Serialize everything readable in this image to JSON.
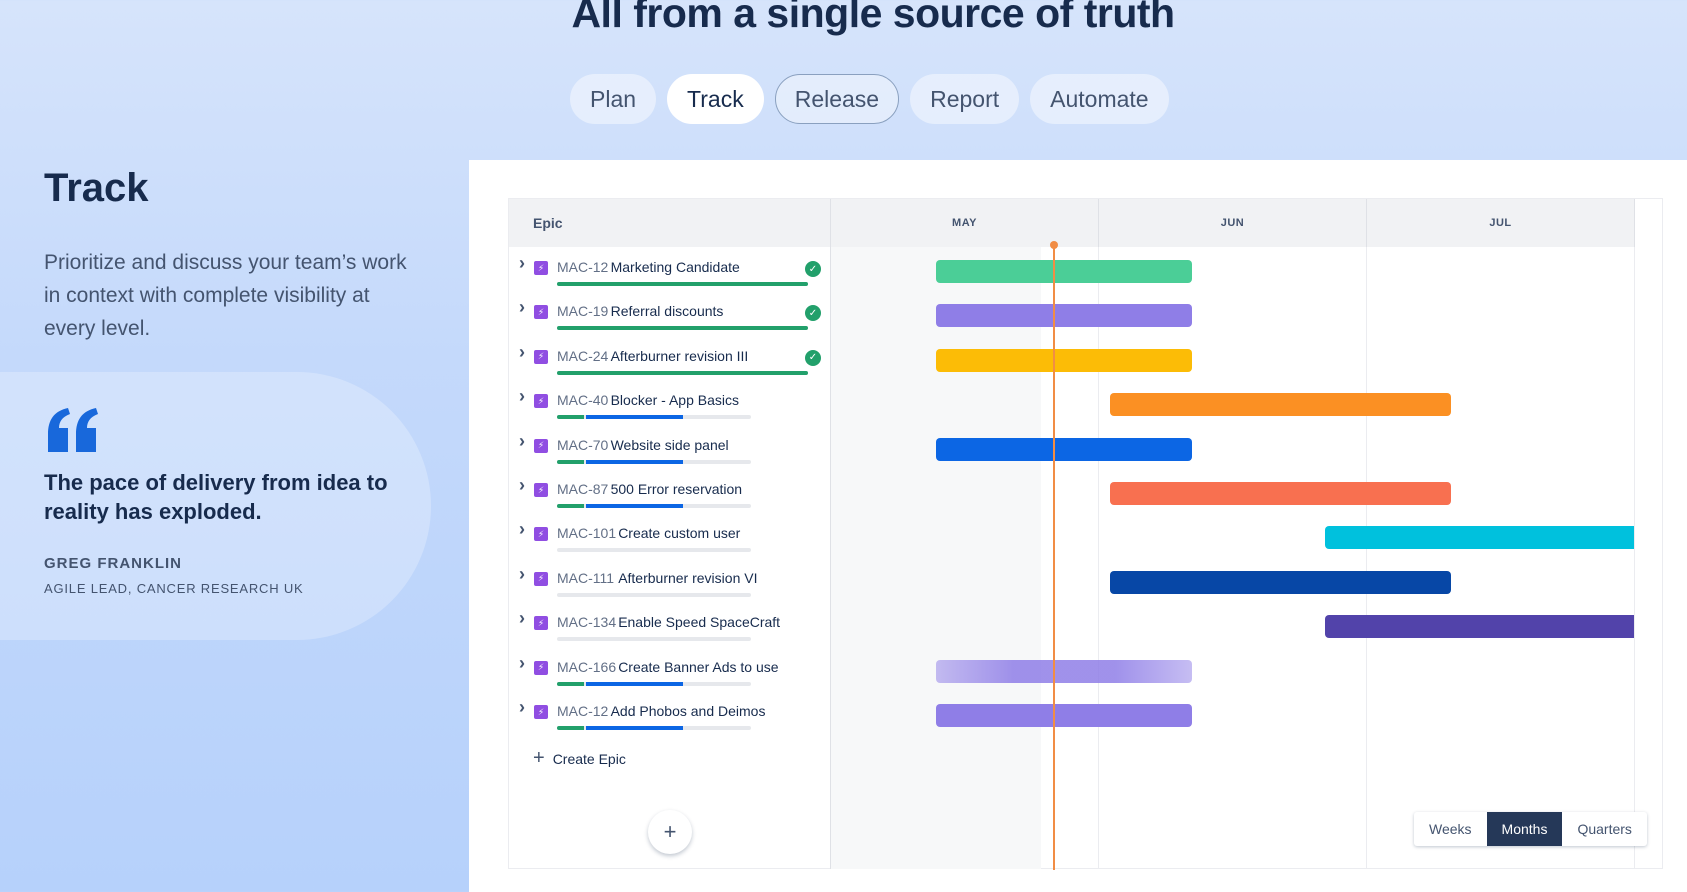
{
  "header": {
    "title": "All from a single source of truth"
  },
  "tabs": [
    {
      "label": "Plan"
    },
    {
      "label": "Track"
    },
    {
      "label": "Release"
    },
    {
      "label": "Report"
    },
    {
      "label": "Automate"
    }
  ],
  "side": {
    "heading": "Track",
    "description": "Prioritize and discuss your team’s work in context with complete visibility at every level.",
    "quote": "The pace of delivery from idea to reality has exploded.",
    "author": "GREG FRANKLIN",
    "role": "AGILE LEAD, CANCER RESEARCH UK"
  },
  "timeline": {
    "epic_header": "Epic",
    "months": [
      "MAY",
      "JUN",
      "JUL"
    ],
    "epics": [
      {
        "key": "MAC-12",
        "name": "Marketing Candidate",
        "done": true,
        "green": 1.0,
        "blue": 0,
        "color": "#4bce97",
        "start_frac": 0.0,
        "end_frac": 0.957
      },
      {
        "key": "MAC-19",
        "name": "Referral discounts",
        "done": true,
        "green": 1.0,
        "blue": 0,
        "color": "#8f7ee7",
        "start_frac": 0.0,
        "end_frac": 0.957
      },
      {
        "key": "MAC-24",
        "name": "Afterburner revision III",
        "done": true,
        "green": 1.0,
        "blue": 0,
        "color": "#fcbc06",
        "start_frac": 0.0,
        "end_frac": 0.957
      },
      {
        "key": "MAC-40",
        "name": "Blocker - App Basics",
        "done": false,
        "green": 0.14,
        "blue": 0.37,
        "color": "#fb9023",
        "start_frac": 0.65,
        "end_frac": 1.92
      },
      {
        "key": "MAC-70",
        "name": "Website side panel",
        "done": false,
        "green": 0.14,
        "blue": 0.37,
        "color": "#0c66e4",
        "start_frac": 0.0,
        "end_frac": 0.957
      },
      {
        "key": "MAC-87",
        "name": "500 Error reservation",
        "done": false,
        "green": 0.14,
        "blue": 0.37,
        "color": "#f87050",
        "start_frac": 0.65,
        "end_frac": 1.92
      },
      {
        "key": "MAC-101",
        "name": "Create custom user",
        "done": false,
        "green": 0,
        "blue": 0,
        "color": "#00c1dd",
        "start_frac": 1.45,
        "end_frac": 2.7
      },
      {
        "key": "MAC-111",
        "name": "Afterburner revision VI",
        "done": false,
        "green": 0,
        "blue": 0,
        "color": "#0747a6",
        "start_frac": 0.65,
        "end_frac": 1.92
      },
      {
        "key": "MAC-134",
        "name": "Enable Speed SpaceCraft",
        "done": false,
        "green": 0,
        "blue": 0,
        "color": "#5243aa",
        "start_frac": 1.45,
        "end_frac": 2.7
      },
      {
        "key": "MAC-166",
        "name": "Create Banner Ads to use",
        "done": false,
        "green": 0.14,
        "blue": 0.37,
        "color": "#8f7ee7",
        "start_frac": 0.0,
        "end_frac": 0.957,
        "fade": true
      },
      {
        "key": "MAC-12",
        "name": "Add Phobos and Deimos",
        "done": false,
        "green": 0.14,
        "blue": 0.37,
        "color": "#8f7ee7",
        "start_frac": 0.0,
        "end_frac": 0.957
      }
    ],
    "create_epic": "Create Epic",
    "add_symbol": "+",
    "zoom": {
      "options": [
        "Weeks",
        "Months",
        "Quarters"
      ],
      "selected": "Months"
    },
    "icons": {
      "expand": "chevron-right-icon",
      "epic": "lightning-icon",
      "done": "check-circle-icon",
      "quote": "quote-icon"
    },
    "colors": {
      "accent": "#0c66e4",
      "today": "#f18d45",
      "done": "#22a06b"
    }
  }
}
